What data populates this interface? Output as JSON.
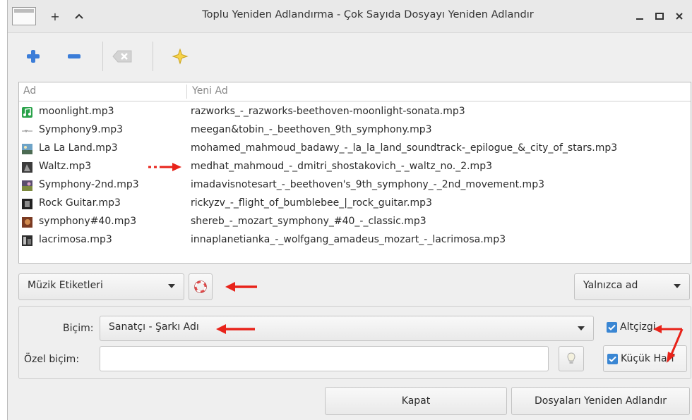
{
  "window": {
    "title": "Toplu Yeniden Adlandırma - Çok Sayıda Dosyayı Yeniden Adlandır",
    "controls": {
      "pin": "+",
      "shade": "^",
      "minimize": "_",
      "maximize": "□",
      "close": "×"
    }
  },
  "toolbar": {
    "add_icon": "plus-icon",
    "remove_icon": "minus-icon",
    "clear_icon": "clear-icon",
    "about_icon": "star-icon"
  },
  "filelist": {
    "columns": [
      "Ad",
      "Yeni Ad"
    ],
    "rows": [
      {
        "name": "moonlight.mp3",
        "new_name": "razworks_-_razworks-beethoven-moonlight-sonata.mp3",
        "icon": "music-note-icon"
      },
      {
        "name": "Symphony9.mp3",
        "new_name": "meegan&tobin_-_beethoven_9th_symphony.mp3",
        "icon": "waveform-icon"
      },
      {
        "name": "La La Land.mp3",
        "new_name": "mohamed_mahmoud_badawy_-_la_la_land_soundtrack-_epilogue_&_city_of_stars.mp3",
        "icon": "album-art-icon"
      },
      {
        "name": "Waltz.mp3",
        "new_name": "medhat_mahmoud_-_dmitri_shostakovich_-_waltz_no._2.mp3",
        "icon": "album-art-icon"
      },
      {
        "name": "Symphony-2nd.mp3",
        "new_name": "imadavisnotesart_-_beethoven's_9th_symphony_-_2nd_movement.mp3",
        "icon": "album-art-icon"
      },
      {
        "name": "Rock Guitar.mp3",
        "new_name": "rickyzv_-_flight_of_bumblebee_|_rock_guitar.mp3",
        "icon": "album-art-icon"
      },
      {
        "name": "symphony#40.mp3",
        "new_name": "shereb_-_mozart_symphony_#40_-_classic.mp3",
        "icon": "album-art-icon"
      },
      {
        "name": "lacrimosa.mp3",
        "new_name": "innaplanetianka_-_wolfgang_amadeus_mozart_-_lacrimosa.mp3",
        "icon": "album-art-icon"
      }
    ]
  },
  "controls": {
    "source_select": "Müzik Etiketleri",
    "help_icon": "lifebuoy-icon",
    "scope_select": "Yalnızca ad"
  },
  "format_panel": {
    "format_label": "Biçim:",
    "format_value": "Sanatçı - Şarkı Adı",
    "custom_label": "Özel biçim:",
    "custom_value": "",
    "hint_icon": "lightbulb-icon",
    "underscore_label": "Altçizgi",
    "underscore_checked": true,
    "lowercase_label": "Küçük Harf",
    "lowercase_checked": true
  },
  "footer": {
    "close_label": "Kapat",
    "rename_label": "Dosyaları Yeniden Adlandır"
  },
  "colors": {
    "accent": "#3a86d3",
    "annotation": "#e8231a"
  }
}
